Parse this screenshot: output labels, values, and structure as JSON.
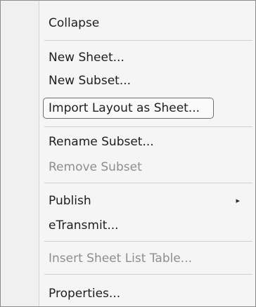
{
  "menu": {
    "items": [
      {
        "label": "Collapse",
        "enabled": true
      },
      {
        "label": "New Sheet...",
        "enabled": true
      },
      {
        "label": "New Subset...",
        "enabled": true
      },
      {
        "label": "Import Layout as Sheet...",
        "enabled": true,
        "highlighted": true
      },
      {
        "label": "Rename Subset...",
        "enabled": true
      },
      {
        "label": "Remove Subset",
        "enabled": false
      },
      {
        "label": "Publish",
        "enabled": true,
        "submenu_arrow": "▸"
      },
      {
        "label": "eTransmit...",
        "enabled": true
      },
      {
        "label": "Insert Sheet List Table...",
        "enabled": false
      },
      {
        "label": "Properties...",
        "enabled": true
      }
    ]
  },
  "colors": {
    "background": "#f5f5f5",
    "text": "#1e1e1e",
    "disabled_text": "#8e8e8e",
    "separator": "#cfcfcf",
    "highlight_border": "#6e6e6e"
  }
}
